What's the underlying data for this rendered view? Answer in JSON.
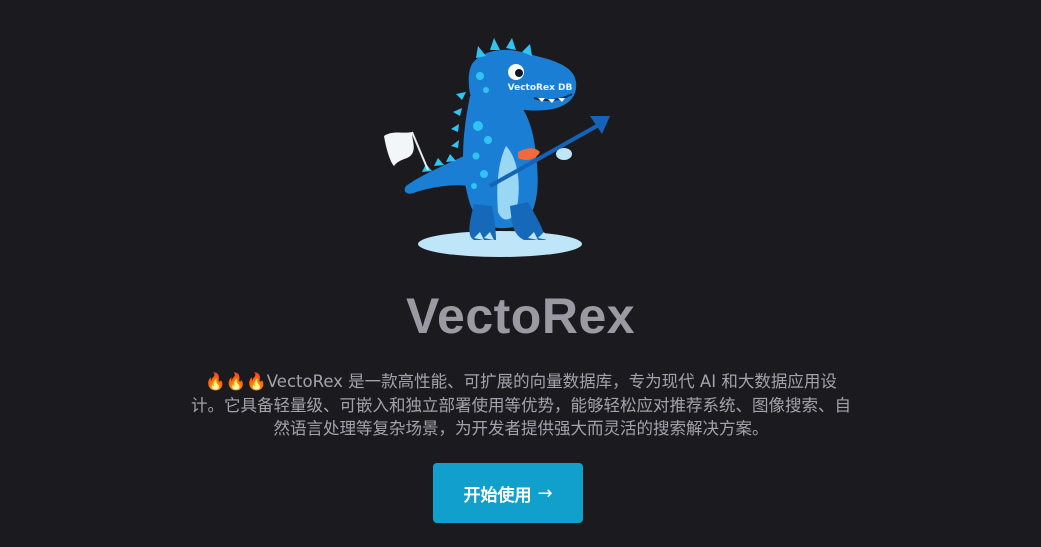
{
  "hero": {
    "title": "VectoRex",
    "tagline_prefix_icons": [
      "fire-icon",
      "fire-icon",
      "fire-icon"
    ],
    "tagline": "VectoRex 是一款高性能、可扩展的向量数据库，专为现代 AI 和大数据应用设计。它具备轻量级、可嵌入和独立部署使用等优势，能够轻松应对推荐系统、图像搜索、自然语言处理等复杂场景，为开发者提供强大而灵活的搜索解决方案。",
    "cta_label": "开始使用",
    "cta_icon": "arrow-right-icon"
  },
  "mascot": {
    "icon": "dinosaur-mascot",
    "chest_text": "VectoRex DB"
  },
  "colors": {
    "background": "#1b1b1f",
    "title": "#9b9aa3",
    "text": "#a3a2ab",
    "cta": "#119fcc",
    "mascot_primary": "#1a7fd4",
    "mascot_accent": "#31c4f3"
  }
}
